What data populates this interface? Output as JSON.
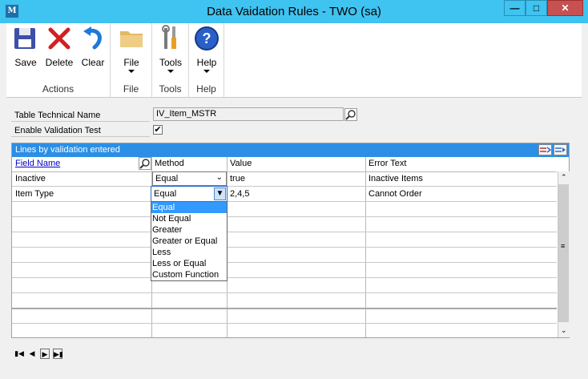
{
  "window": {
    "title": "Data Vaidation Rules  -  TWO (sa)"
  },
  "ribbon": {
    "groups": [
      {
        "label": "Actions",
        "buttons": [
          {
            "label": "Save",
            "icon": "save-icon"
          },
          {
            "label": "Delete",
            "icon": "delete-icon"
          },
          {
            "label": "Clear",
            "icon": "clear-icon"
          }
        ]
      },
      {
        "label": "File",
        "buttons": [
          {
            "label": "File",
            "icon": "folder-icon"
          }
        ]
      },
      {
        "label": "Tools",
        "buttons": [
          {
            "label": "Tools",
            "icon": "tools-icon"
          }
        ]
      },
      {
        "label": "Help",
        "buttons": [
          {
            "label": "Help",
            "icon": "help-icon"
          }
        ]
      }
    ]
  },
  "form": {
    "table_technical_name_label": "Table Technical Name",
    "table_technical_name_value": "IV_Item_MSTR",
    "enable_validation_label": "Enable Validation Test",
    "enable_validation_checked": "✔"
  },
  "grid": {
    "header": "Lines by validation entered",
    "columns": [
      "Field Name",
      "Method",
      "Value",
      "Error Text"
    ],
    "rows": [
      {
        "field": "Inactive",
        "method": "Equal",
        "value": "true",
        "error": "Inactive Items"
      },
      {
        "field": "Item Type",
        "method": "Equal",
        "value": "2,4,5",
        "error": "Cannot Order"
      }
    ]
  },
  "dropdown": {
    "options": [
      "Equal",
      "Not Equal",
      "Greater",
      "Greater or Equal",
      "Less",
      "Less or Equal",
      "Custom Function"
    ],
    "selected": "Equal"
  },
  "colors": {
    "titlebar": "#3fc3f0",
    "grid_header": "#2b8fe5",
    "selection": "#3399ff"
  }
}
